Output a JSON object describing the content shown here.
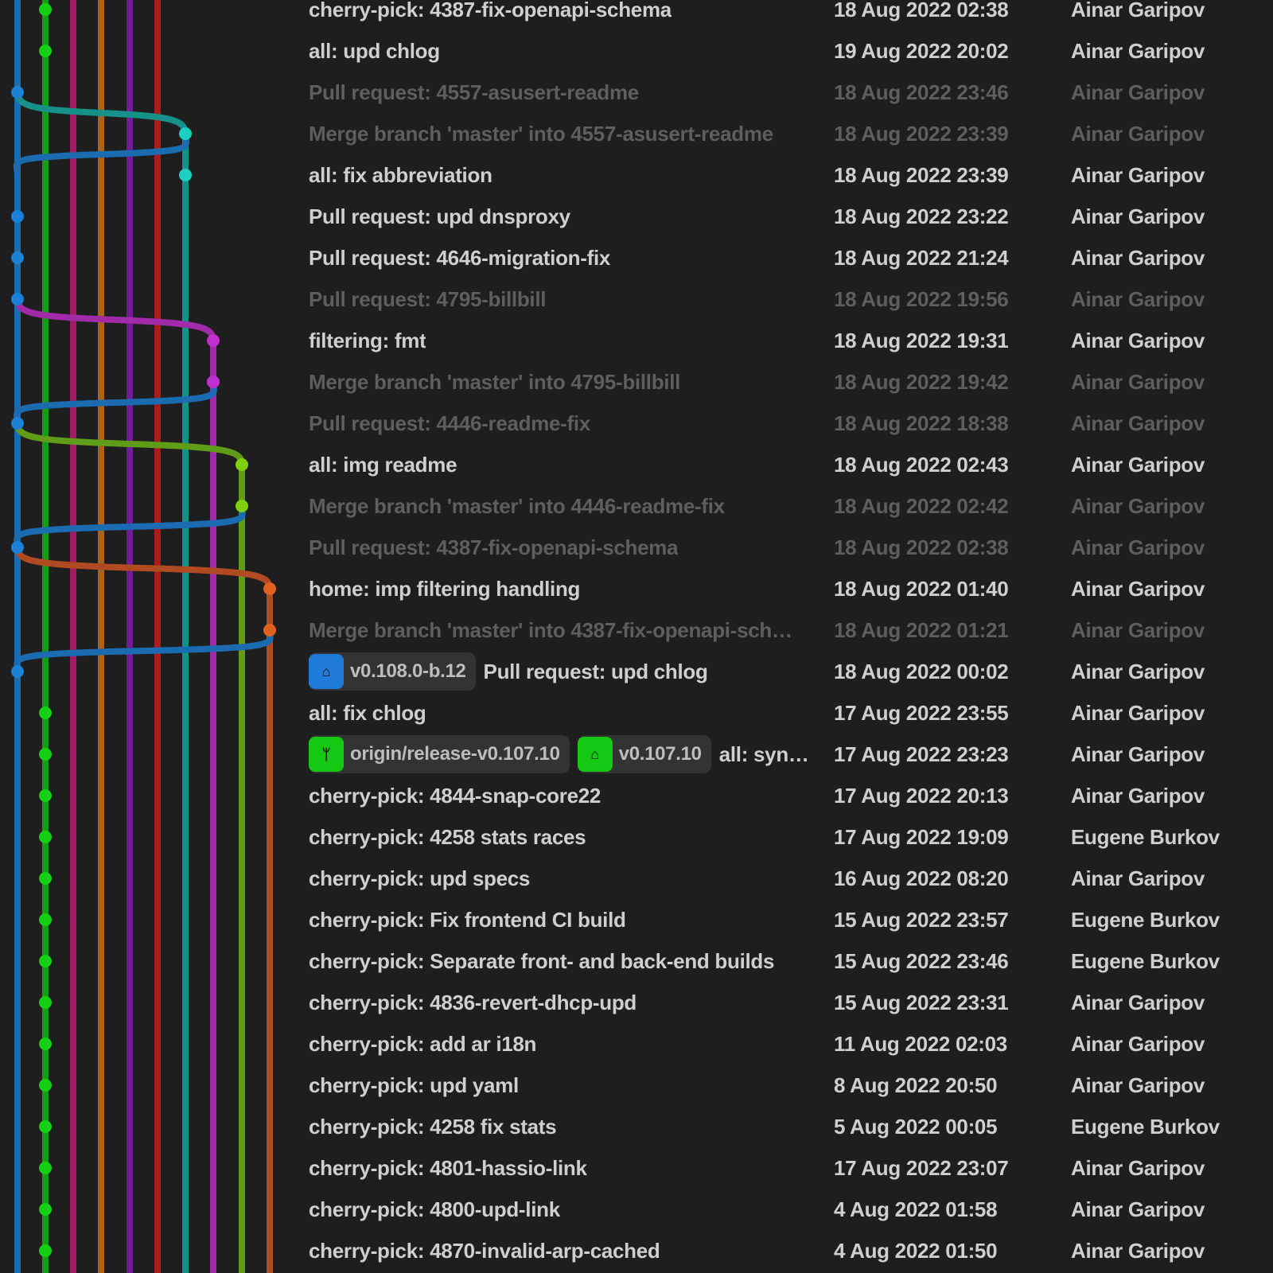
{
  "colors": {
    "lanes": [
      "#1a6bb0",
      "#169a1a",
      "#a01c64",
      "#a8621c",
      "#6f1c96",
      "#a81c1c",
      "#15918a",
      "#a02aa8",
      "#5f9c18",
      "#b04a20"
    ],
    "dots": [
      "#1a80d8",
      "#14d014",
      "#c02080",
      "#d07a20",
      "#8a20c0",
      "#d02020",
      "#1ad0c0",
      "#c030d0",
      "#80d010",
      "#e06020"
    ],
    "tag_blue": "#1f7ad8",
    "tag_green": "#14c814"
  },
  "commits": [
    {
      "message": "cherry-pick: 4387-fix-openapi-schema",
      "date": "18 Aug 2022 02:38",
      "author": "Ainar Garipov",
      "lane": 1,
      "dim": false
    },
    {
      "message": "all: upd chlog",
      "date": "19 Aug 2022 20:02",
      "author": "Ainar Garipov",
      "lane": 1,
      "dim": false
    },
    {
      "message": "Pull request: 4557-asusert-readme",
      "date": "18 Aug 2022 23:46",
      "author": "Ainar Garipov",
      "lane": 0,
      "dim": true
    },
    {
      "message": "Merge branch 'master' into 4557-asusert-readme",
      "date": "18 Aug 2022 23:39",
      "author": "Ainar Garipov",
      "lane": 6,
      "dim": true
    },
    {
      "message": "all: fix abbreviation",
      "date": "18 Aug 2022 23:39",
      "author": "Ainar Garipov",
      "lane": 6,
      "dim": false
    },
    {
      "message": "Pull request: upd dnsproxy",
      "date": "18 Aug 2022 23:22",
      "author": "Ainar Garipov",
      "lane": 0,
      "dim": false
    },
    {
      "message": "Pull request: 4646-migration-fix",
      "date": "18 Aug 2022 21:24",
      "author": "Ainar Garipov",
      "lane": 0,
      "dim": false
    },
    {
      "message": "Pull request: 4795-billbill",
      "date": "18 Aug 2022 19:56",
      "author": "Ainar Garipov",
      "lane": 0,
      "dim": true
    },
    {
      "message": "filtering: fmt",
      "date": "18 Aug 2022 19:31",
      "author": "Ainar Garipov",
      "lane": 7,
      "dim": false
    },
    {
      "message": "Merge branch 'master' into 4795-billbill",
      "date": "18 Aug 2022 19:42",
      "author": "Ainar Garipov",
      "lane": 7,
      "dim": true
    },
    {
      "message": "Pull request: 4446-readme-fix",
      "date": "18 Aug 2022 18:38",
      "author": "Ainar Garipov",
      "lane": 0,
      "dim": true
    },
    {
      "message": "all: img readme",
      "date": "18 Aug 2022 02:43",
      "author": "Ainar Garipov",
      "lane": 8,
      "dim": false
    },
    {
      "message": "Merge branch 'master' into 4446-readme-fix",
      "date": "18 Aug 2022 02:42",
      "author": "Ainar Garipov",
      "lane": 8,
      "dim": true
    },
    {
      "message": "Pull request: 4387-fix-openapi-schema",
      "date": "18 Aug 2022 02:38",
      "author": "Ainar Garipov",
      "lane": 0,
      "dim": true
    },
    {
      "message": "home: imp filtering handling",
      "date": "18 Aug 2022 01:40",
      "author": "Ainar Garipov",
      "lane": 9,
      "dim": false
    },
    {
      "message": "Merge branch 'master' into 4387-fix-openapi-sch…",
      "date": "18 Aug 2022 01:21",
      "author": "Ainar Garipov",
      "lane": 9,
      "dim": true
    },
    {
      "message": "Pull request: upd chlog",
      "date": "18 Aug 2022 00:02",
      "author": "Ainar Garipov",
      "lane": 0,
      "dim": false,
      "refs": [
        {
          "label": "v0.108.0-b.12",
          "kind": "tag",
          "color": "blue"
        }
      ]
    },
    {
      "message": "all: fix chlog",
      "date": "17 Aug 2022 23:55",
      "author": "Ainar Garipov",
      "lane": 1,
      "dim": false
    },
    {
      "message": "all: syn…",
      "date": "17 Aug 2022 23:23",
      "author": "Ainar Garipov",
      "lane": 1,
      "dim": false,
      "refs": [
        {
          "label": "origin/release-v0.107.10",
          "kind": "branch",
          "color": "green"
        },
        {
          "label": "v0.107.10",
          "kind": "tag",
          "color": "green"
        }
      ]
    },
    {
      "message": "cherry-pick: 4844-snap-core22",
      "date": "17 Aug 2022 20:13",
      "author": "Ainar Garipov",
      "lane": 1,
      "dim": false
    },
    {
      "message": "cherry-pick: 4258 stats races",
      "date": "17 Aug 2022 19:09",
      "author": "Eugene Burkov",
      "lane": 1,
      "dim": false
    },
    {
      "message": "cherry-pick: upd specs",
      "date": "16 Aug 2022 08:20",
      "author": "Ainar Garipov",
      "lane": 1,
      "dim": false
    },
    {
      "message": "cherry-pick: Fix frontend CI build",
      "date": "15 Aug 2022 23:57",
      "author": "Eugene Burkov",
      "lane": 1,
      "dim": false
    },
    {
      "message": "cherry-pick: Separate front- and back-end builds",
      "date": "15 Aug 2022 23:46",
      "author": "Eugene Burkov",
      "lane": 1,
      "dim": false
    },
    {
      "message": "cherry-pick: 4836-revert-dhcp-upd",
      "date": "15 Aug 2022 23:31",
      "author": "Ainar Garipov",
      "lane": 1,
      "dim": false
    },
    {
      "message": "cherry-pick: add ar i18n",
      "date": "11 Aug 2022 02:03",
      "author": "Ainar Garipov",
      "lane": 1,
      "dim": false
    },
    {
      "message": "cherry-pick: upd yaml",
      "date": "8 Aug 2022 20:50",
      "author": "Ainar Garipov",
      "lane": 1,
      "dim": false
    },
    {
      "message": "cherry-pick: 4258 fix stats",
      "date": "5 Aug 2022 00:05",
      "author": "Eugene Burkov",
      "lane": 1,
      "dim": false
    },
    {
      "message": "cherry-pick: 4801-hassio-link",
      "date": "17 Aug 2022 23:07",
      "author": "Ainar Garipov",
      "lane": 1,
      "dim": false
    },
    {
      "message": "cherry-pick: 4800-upd-link",
      "date": "4 Aug 2022 01:58",
      "author": "Ainar Garipov",
      "lane": 1,
      "dim": false
    },
    {
      "message": "cherry-pick: 4870-invalid-arp-cached",
      "date": "4 Aug 2022 01:50",
      "author": "Ainar Garipov",
      "lane": 1,
      "dim": false
    }
  ]
}
